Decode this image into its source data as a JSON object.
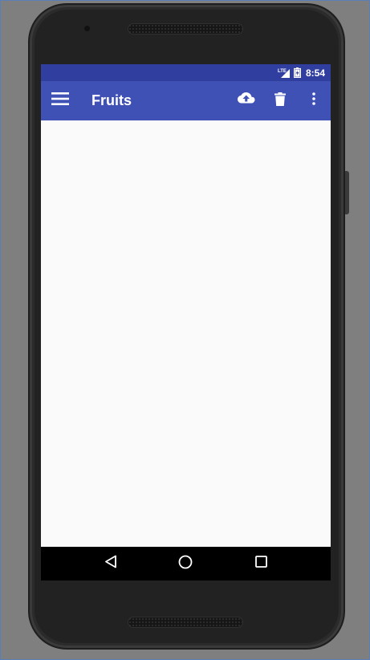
{
  "status_bar": {
    "network": "LTE",
    "time": "8:54"
  },
  "app_bar": {
    "title": "Fruits",
    "menu_icon": "hamburger-menu-icon",
    "actions": [
      {
        "icon": "cloud-upload-icon"
      },
      {
        "icon": "delete-icon"
      },
      {
        "icon": "more-vert-icon"
      }
    ]
  },
  "nav_bar": {
    "buttons": [
      {
        "icon": "back-icon"
      },
      {
        "icon": "home-icon"
      },
      {
        "icon": "recents-icon"
      }
    ]
  },
  "colors": {
    "status_bar": "#303f9f",
    "app_bar": "#3f51b5",
    "content_bg": "#fafafa",
    "nav_bar": "#000000"
  }
}
